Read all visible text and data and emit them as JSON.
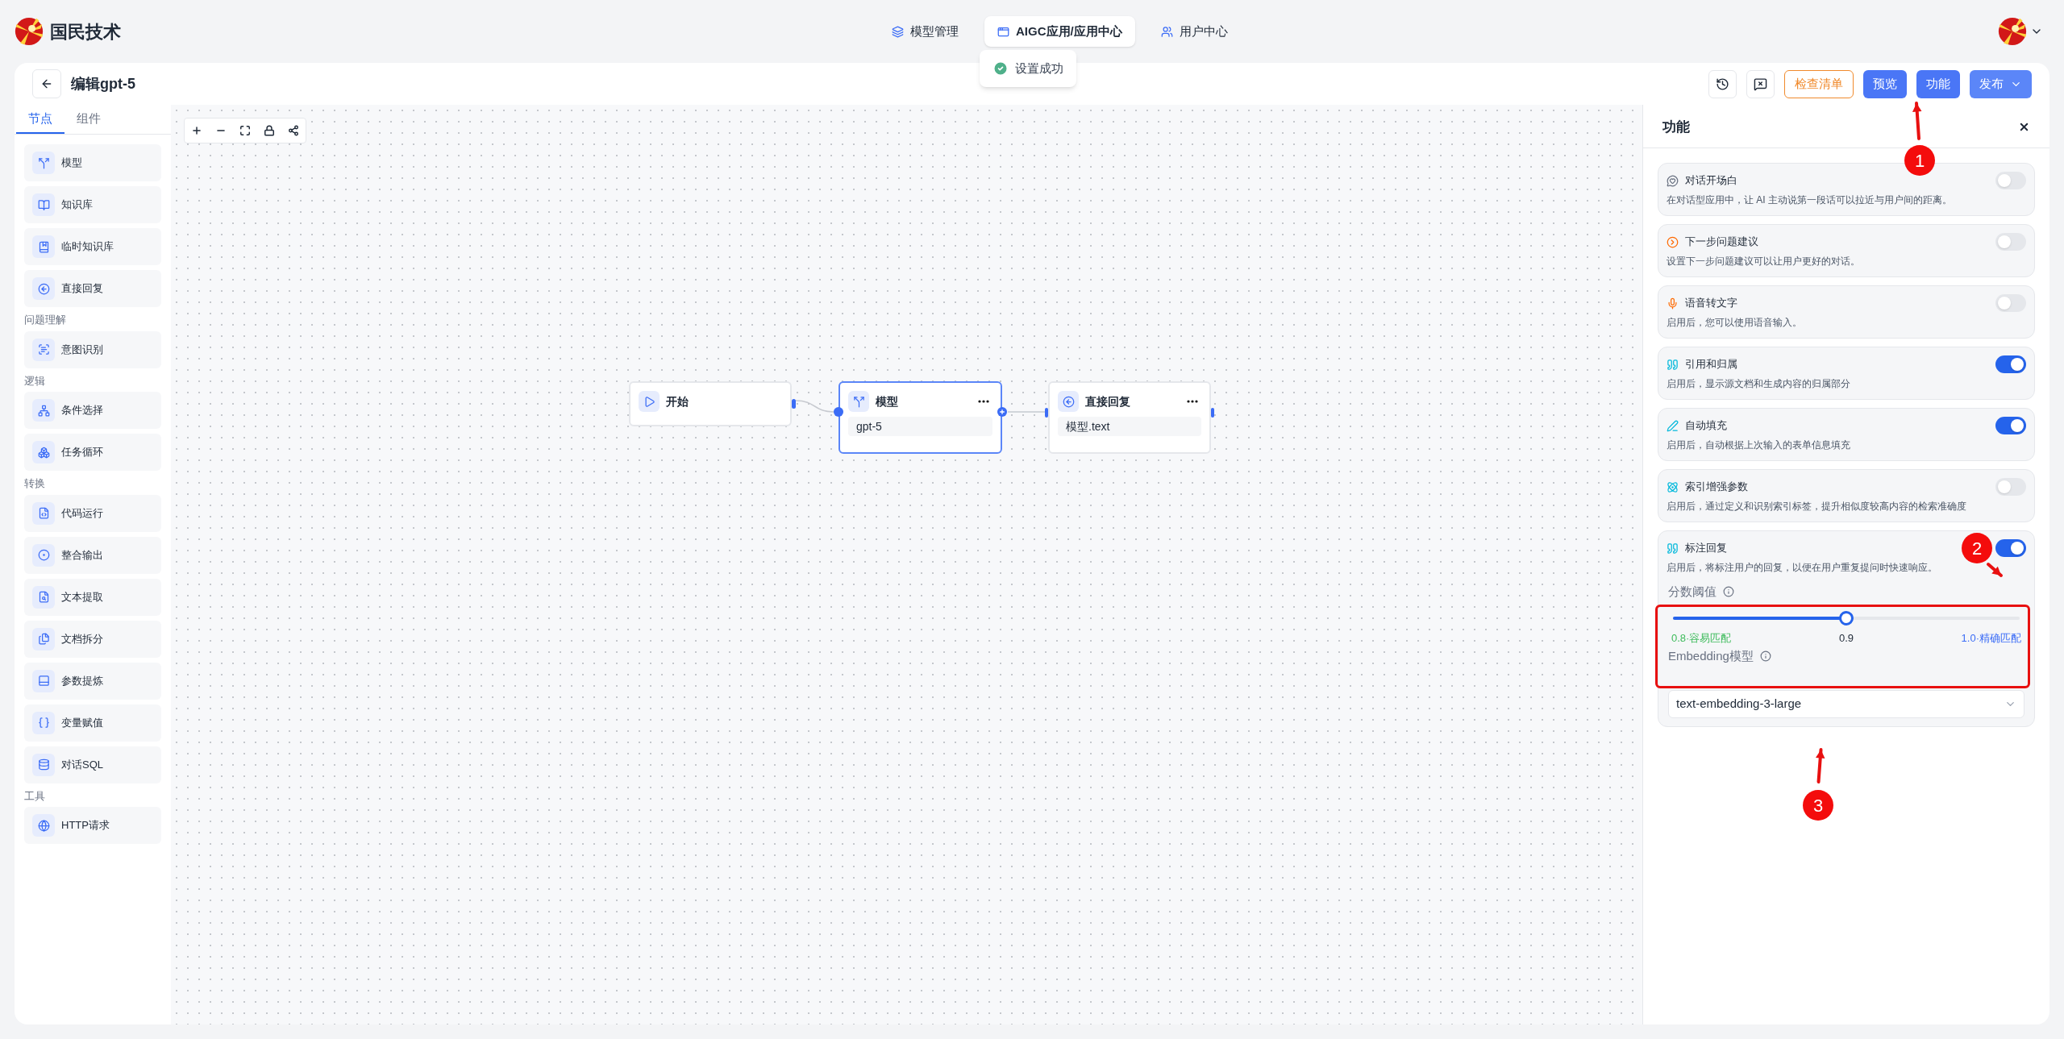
{
  "brand": {
    "name": "国民技术"
  },
  "nav": [
    {
      "label": "模型管理",
      "selected": false
    },
    {
      "label": "AIGC应用/应用中心",
      "selected": true
    },
    {
      "label": "用户中心",
      "selected": false
    }
  ],
  "toast": {
    "text": "设置成功"
  },
  "editor": {
    "title": "编辑gpt-5",
    "buttons": [
      {
        "label": "检查清单",
        "kind": "outline"
      },
      {
        "label": "预览",
        "kind": "primary"
      },
      {
        "label": "功能",
        "kind": "primary"
      },
      {
        "label": "发布",
        "kind": "dropdown"
      }
    ]
  },
  "sidebar": {
    "tabs": [
      {
        "label": "节点",
        "selected": true
      },
      {
        "label": "组件",
        "selected": false
      }
    ],
    "groups": [
      {
        "items": [
          "模型",
          "知识库",
          "临时知识库",
          "直接回复"
        ]
      },
      {
        "title": "问题理解",
        "items": [
          "意图识别"
        ]
      },
      {
        "title": "逻辑",
        "items": [
          "条件选择",
          "任务循环"
        ]
      },
      {
        "title": "转换",
        "items": [
          "代码运行",
          "整合输出",
          "文本提取",
          "文档拆分",
          "参数提炼",
          "变量赋值",
          "对话SQL"
        ]
      },
      {
        "title": "工具",
        "items": [
          "HTTP请求"
        ]
      }
    ]
  },
  "nodes": [
    {
      "title": "开始",
      "selected": false
    },
    {
      "title": "模型",
      "value": "gpt-5",
      "selected": true
    },
    {
      "title": "直接回复",
      "value": "模型.text",
      "selected": false
    }
  ],
  "panel": {
    "title": "功能",
    "features": [
      {
        "title": "对话开场白",
        "description": "在对话型应用中，让 AI 主动说第一段话可以拉近与用户间的距离。",
        "on": false
      },
      {
        "title": "下一步问题建议",
        "description": "设置下一步问题建议可以让用户更好的对话。",
        "on": false
      },
      {
        "title": "语音转文字",
        "description": "启用后，您可以使用语音输入。",
        "on": false
      },
      {
        "title": "引用和归属",
        "description": "启用后，显示源文档和生成内容的归属部分",
        "on": true
      },
      {
        "title": "自动填充",
        "description": "启用后，自动根据上次输入的表单信息填充",
        "on": true
      },
      {
        "title": "索引增强参数",
        "description": "启用后，通过定义和识别索引标签，提升相似度较高内容的检索准确度",
        "on": false
      },
      {
        "title": "标注回复",
        "description": "启用后，将标注用户的回复，以便在用户重复提问时快速响应。",
        "on": true,
        "threshold": {
          "label": "分数阈值",
          "level": 0.5,
          "value": "0.9",
          "min_label": "0.8·容易匹配",
          "max_label": "1.0·精确匹配"
        },
        "embedding": {
          "label": "Embedding模型",
          "value": "text-embedding-3-large"
        }
      }
    ]
  },
  "annotations": [
    {
      "number": "1"
    },
    {
      "number": "2"
    },
    {
      "number": "3"
    }
  ]
}
